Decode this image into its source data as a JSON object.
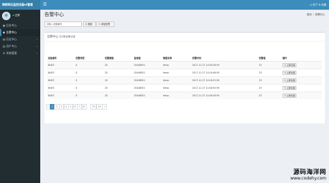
{
  "topbar": {
    "brand": "物联网云监控设备ui管理",
    "menu_icon": "☰",
    "user_text": "◎ 在宁 ⚙ 设置"
  },
  "sidebar": {
    "user_status": "正常",
    "items": [
      {
        "icon": "▣",
        "label": "后台中心",
        "chevron": ""
      },
      {
        "icon": "◉",
        "label": "告警中心",
        "chevron": ""
      },
      {
        "icon": "▤",
        "label": "历史中心",
        "chevron": "‹"
      },
      {
        "icon": "▥",
        "label": "用户中心",
        "chevron": "‹"
      },
      {
        "icon": "⚙",
        "label": "系统管理",
        "chevron": "‹"
      }
    ]
  },
  "page": {
    "title": "告警中心",
    "breadcrumb": [
      "首页",
      "告警中心"
    ]
  },
  "search": {
    "placeholder": "请输入设备编号",
    "search_label": "Q 搜索",
    "add_label": "✎ 添加告警"
  },
  "box": {
    "title": "告警中心",
    "count_text": "共5条告警记录"
  },
  "table": {
    "headers": [
      "设备编号",
      "告警类型",
      "告警阈值",
      "监测值",
      "数据名称",
      "告警时间",
      "告警值",
      "操作"
    ],
    "rows": [
      [
        "8I4E3",
        "X",
        "20",
        "20448501",
        "temp",
        "2017-11-27 14:00:36 H3",
        "23",
        "✎ 立即处理"
      ],
      [
        "8I4E3",
        "X",
        "20",
        "20448501",
        "temp",
        "2017-11-27 14:16:48 H5",
        "23",
        "✎ 立即处理"
      ],
      [
        "8I4E3",
        "X",
        "20",
        "20448501",
        "temp",
        "2017-11-27 14:16:15 H5",
        "23",
        "✎ 立即处理"
      ],
      [
        "8I4E3",
        "X",
        "20",
        "20448501",
        "temp",
        "2017-11-27 14:46:50 H5",
        "23",
        "✎ 立即处理"
      ],
      [
        "8I4E3",
        "X",
        "20",
        "20448501",
        "temp",
        "2017-11-27 14:46:28 H5",
        "23",
        "✎ 立即处理"
      ]
    ]
  },
  "pagination": {
    "prev": "«",
    "pages": [
      "1",
      "2",
      "3",
      "4",
      "5",
      "6",
      "7",
      "8"
    ],
    "current": "1",
    "far_pages": [
      "33",
      "34"
    ],
    "next": "»"
  },
  "watermark": {
    "title": "源码海洋网",
    "url": "www.codehy.com"
  },
  "colors": {
    "header": "#3c8dbc",
    "brand": "#367fa9",
    "sidebar": "#222d32",
    "content_bg": "#ecf0f5"
  }
}
